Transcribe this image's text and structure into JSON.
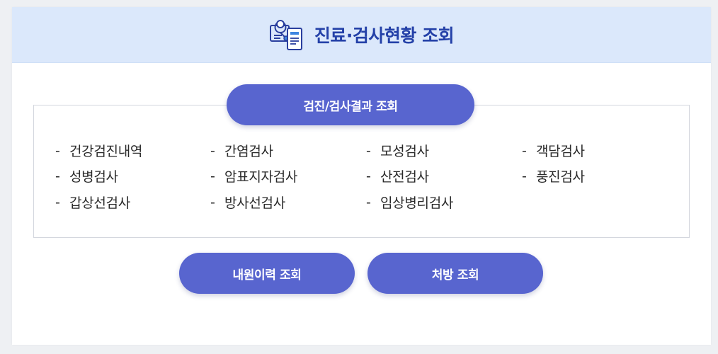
{
  "header": {
    "title": "진료·검사현황 조회",
    "icon": "medical-document-stethoscope-icon",
    "background": "#dbe8fb",
    "title_color": "#2441a8"
  },
  "exam_section": {
    "title": "검진/검사결과 조회",
    "items": [
      "건강검진내역",
      "간염검사",
      "모성검사",
      "객담검사",
      "성병검사",
      "암표지자검사",
      "산전검사",
      "풍진검사",
      "갑상선검사",
      "방사선검사",
      "임상병리검사"
    ],
    "dash": "-"
  },
  "buttons": {
    "visit_history": "내원이력 조회",
    "prescription": "처방 조회",
    "color": "#5865cf"
  }
}
